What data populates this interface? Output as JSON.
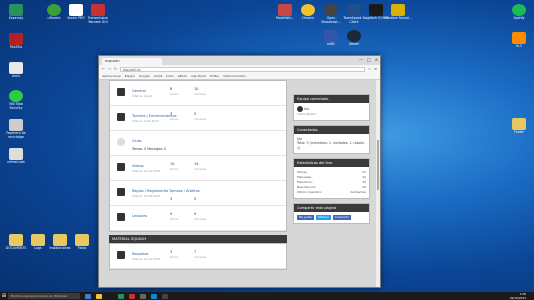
{
  "desktop_icons": [
    {
      "label": "Kapersky",
      "color": "#2a8f5a"
    },
    {
      "label": "FileZilla",
      "color": "#b22222"
    },
    {
      "label": "arxiu",
      "color": "#e8e8e8"
    },
    {
      "label": "360 Total Security",
      "color": "#2ecc40"
    },
    {
      "label": "Paperera de reciclatge",
      "color": "#cccccc"
    },
    {
      "label": "refresh.bat",
      "color": "#dddddd"
    },
    {
      "label": "uTorrent",
      "color": "#3aa03a"
    },
    {
      "label": "Xunlei PRO",
      "color": "#ffffff"
    },
    {
      "label": "Transmission Remote GUI",
      "color": "#c83232"
    },
    {
      "label": "MovieWiz...",
      "color": "#c84646"
    },
    {
      "label": "Chrome",
      "color": "#f2c230"
    },
    {
      "label": "Open Broadcast...",
      "color": "#444444"
    },
    {
      "label": "TeamSpeak 3 Client",
      "color": "#1e4f8a"
    },
    {
      "label": "Logitech G HUB",
      "color": "#1a1a1a"
    },
    {
      "label": "Creative Sound...",
      "color": "#d9b200"
    },
    {
      "label": "Spotify",
      "color": "#1db954"
    },
    {
      "label": "VLC",
      "color": "#ff8c00"
    },
    {
      "label": "mIRC",
      "color": "#3355aa"
    },
    {
      "label": "Steam",
      "color": "#1b2838"
    },
    {
      "label": "Folder",
      "color": "#e8c860"
    },
    {
      "label": "DOCUMENTS",
      "color": "#e8c860"
    },
    {
      "label": "Logs",
      "color": "#e8c860"
    },
    {
      "label": "Instalaciones",
      "color": "#e8c860"
    },
    {
      "label": "Fotos",
      "color": "#e8c860"
    }
  ],
  "browser": {
    "tab_title": "esquash",
    "url": "esquash.es",
    "window_controls": [
      "—",
      "□",
      "✕"
    ],
    "bookmarks": [
      "Aplicaciones",
      "Equipo",
      "Google",
      "Gmail",
      "Docs",
      "eBook",
      "Cap Rural",
      "Tuitter",
      "Visita miembro"
    ]
  },
  "forums": [
    {
      "title": "General",
      "sub": "Últimos: Grand",
      "n1": "8",
      "n2": "10",
      "l1": "temas",
      "l2": "mensajes",
      "icon": "book-icon"
    },
    {
      "title": "Torneos / Entrenamientos",
      "sub": "Últimos: 3 abr 2015",
      "n1": "3",
      "n2": "5",
      "l1": "temas",
      "l2": "mensajes",
      "icon": "book-icon"
    },
    {
      "title": "Clubs",
      "sub": "Temas: 0 Mensajes: 0",
      "n1": "",
      "n2": "",
      "l1": "",
      "l2": "",
      "icon": "cloud-icon"
    },
    {
      "title": "Videos",
      "sub": "Últimos: 16 abr 2015",
      "n1": "10",
      "n2": "14",
      "l1": "temas",
      "l2": "mensajes",
      "icon": "book-icon"
    },
    {
      "title": "Reglas / Reglamento Torneos / Árbitros",
      "sub": "Últimos: 25 feb 2015",
      "n1": "3",
      "n2": "5",
      "l1": "temas",
      "l2": "mensajes",
      "icon": "book-icon"
    },
    {
      "title": "Lesiones",
      "sub": "",
      "n1": "0",
      "n2": "0",
      "l1": "temas",
      "l2": "mensajes",
      "icon": "book-icon"
    }
  ],
  "category2": {
    "title": "MATERIAL SQUASH",
    "rows": [
      {
        "title": "Raquetas",
        "sub": "Últimos: 19 abr 2015",
        "n1": "3",
        "n2": "7",
        "l1": "temas",
        "l2": "mensajes",
        "icon": "book-icon"
      }
    ]
  },
  "sidebar": {
    "connected_title": "Equipo conectado",
    "connected_user": "Ulo",
    "connected_role": "Administrator",
    "online_title": "Conectados",
    "online_user": "Ulo",
    "online_summary": "Total: 3 (miembros: 1, invitados: 1, robots: 1)",
    "stats_title": "Estadísticas del foro",
    "stats": [
      {
        "label": "Temas:",
        "value": "21"
      },
      {
        "label": "Mensajes:",
        "value": "42"
      },
      {
        "label": "Miembros:",
        "value": "30"
      },
      {
        "label": "New Record:",
        "value": "30"
      },
      {
        "label": "Último miembro:",
        "value": "deimantas"
      }
    ],
    "share_title": "Compartir esta página",
    "share_buttons": [
      "Me gusta",
      "Twittear",
      "Compartir"
    ]
  },
  "taskbar": {
    "search_placeholder": "Escribe aquí para buscar en Windows",
    "time": "1:56",
    "date": "02/10/2015",
    "icon_colors": [
      "#3c7ed9",
      "#f2c230",
      "#1a1a1a",
      "#2a8f5a",
      "#c83232",
      "#666666",
      "#0b8bd6",
      "#444444"
    ]
  }
}
